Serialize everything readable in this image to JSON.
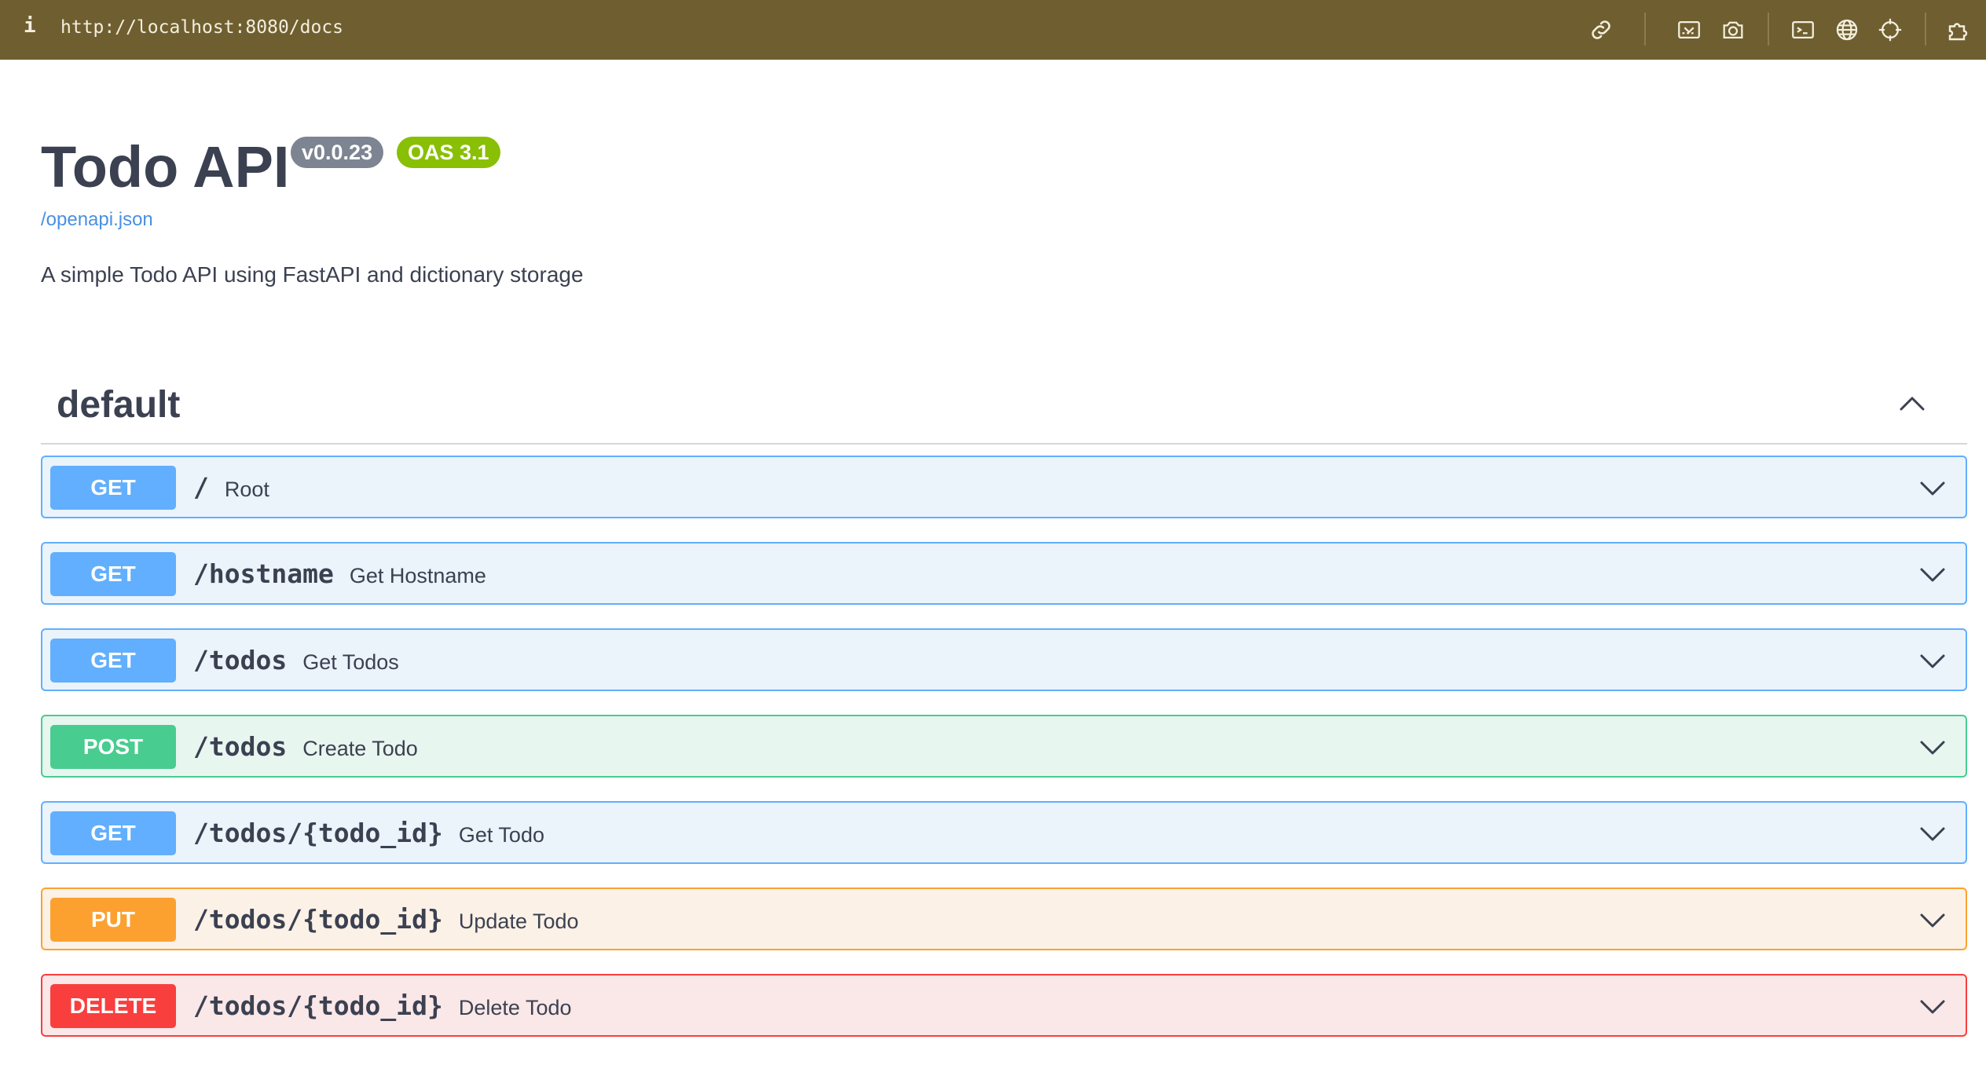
{
  "browser": {
    "info_icon": "info-icon",
    "url": "http://localhost:8080/docs",
    "toolbar_icons": [
      "link-icon",
      "screenshot-area-icon",
      "camera-icon",
      "terminal-icon",
      "globe-icon",
      "crosshair-icon",
      "puzzle-icon"
    ]
  },
  "info": {
    "title": "Todo API",
    "version": "v0.0.23",
    "oas": "OAS 3.1",
    "spec_link": "/openapi.json",
    "description": "A simple Todo API using FastAPI and dictionary storage"
  },
  "section": {
    "name": "default",
    "expanded": true
  },
  "operations": [
    {
      "method": "GET",
      "path": "/",
      "summary": "Root"
    },
    {
      "method": "GET",
      "path": "/hostname",
      "summary": "Get Hostname"
    },
    {
      "method": "GET",
      "path": "/todos",
      "summary": "Get Todos"
    },
    {
      "method": "POST",
      "path": "/todos",
      "summary": "Create Todo"
    },
    {
      "method": "GET",
      "path": "/todos/{todo_id}",
      "summary": "Get Todo"
    },
    {
      "method": "PUT",
      "path": "/todos/{todo_id}",
      "summary": "Update Todo"
    },
    {
      "method": "DELETE",
      "path": "/todos/{todo_id}",
      "summary": "Delete Todo"
    }
  ],
  "colors": {
    "toolbar": "#6f5f30",
    "get": "#61affe",
    "post": "#49cc90",
    "put": "#fca130",
    "delete": "#f93e3e"
  }
}
